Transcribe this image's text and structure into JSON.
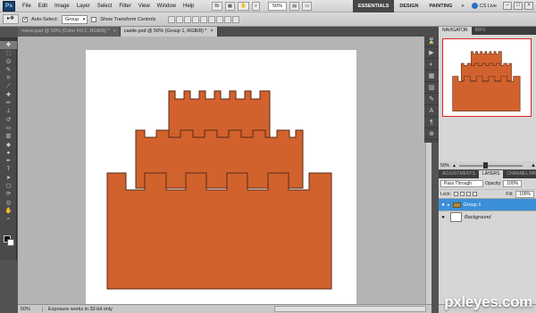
{
  "app": {
    "logo": "Ps",
    "zoom": "50%"
  },
  "menu": [
    "File",
    "Edit",
    "Image",
    "Layer",
    "Select",
    "Filter",
    "View",
    "Window",
    "Help"
  ],
  "workspaces": {
    "essentials": "ESSENTIALS",
    "design": "DESIGN",
    "painting": "PAINTING",
    "more": "»",
    "cs_live": "CS Live"
  },
  "options_bar": {
    "auto_select_label": "Auto-Select:",
    "auto_select_value": "Group",
    "transform_label": "Show Transform Controls"
  },
  "doc_tabs": [
    "mario.psd @ 50% (Color Fill 2, RGB/8) *",
    "castle.psd @ 50% (Group 1, RGB/8) *"
  ],
  "status": {
    "zoom": "50%",
    "message": "Exposure works in 32-bit only"
  },
  "navigator": {
    "tabs": [
      "NAVIGATOR",
      "INFO"
    ],
    "zoom": "50%"
  },
  "layers_panel": {
    "tabs": [
      "ADJUSTMENTS",
      "LAYERS",
      "CHANNEL PATHS"
    ],
    "blend_mode": "Pass Through",
    "opacity_label": "Opacity:",
    "opacity_value": "100%",
    "lock_label": "Lock:",
    "fill_label": "Fill:",
    "fill_value": "100%",
    "layers": [
      {
        "name": "Group 1",
        "selected": true
      },
      {
        "name": "Background",
        "selected": false
      }
    ]
  },
  "castle_color": "#d2622d",
  "watermark": "pxleyes.com"
}
